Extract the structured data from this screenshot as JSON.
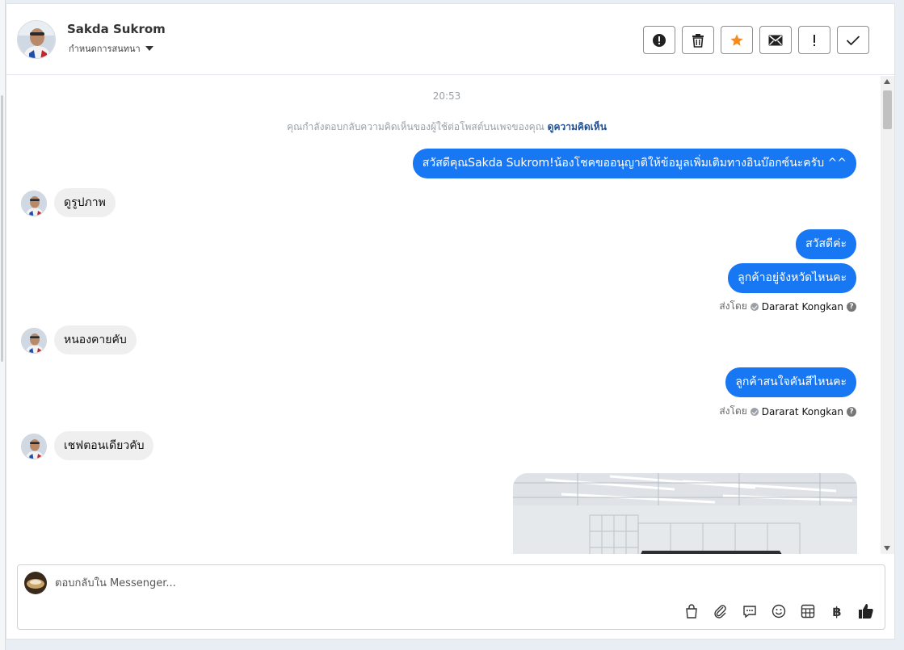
{
  "header": {
    "contact_name": "Sakda Sukrom",
    "conversation_label": "กำหนดการสนทนา",
    "actions": [
      {
        "name": "spam-button",
        "icon": "alert-circle-icon"
      },
      {
        "name": "delete-button",
        "icon": "trash-icon"
      },
      {
        "name": "star-button",
        "icon": "star-icon"
      },
      {
        "name": "mark-unread-button",
        "icon": "envelope-icon"
      },
      {
        "name": "important-button",
        "icon": "exclamation-icon"
      },
      {
        "name": "done-button",
        "icon": "check-icon"
      }
    ]
  },
  "thread": {
    "timestamp": "20:53",
    "reply_notice": "คุณกำลังตอบกลับความคิดเห็นของผู้ใช้ต่อโพสต์บนเพจของคุณ",
    "view_comment_link": "ดูความคิดเห็น",
    "messages": [
      {
        "direction": "out",
        "text": "สวัสดีคุณSakda Sukrom!น้องโชคขออนุญาติให้ข้อมูลเพิ่มเติมทางอินบ๊อกซ์นะครับ ^^"
      },
      {
        "direction": "in",
        "text": "ดูรูปภาพ"
      },
      {
        "direction": "out",
        "text": "สวัสดีค่ะ"
      },
      {
        "direction": "out",
        "text": "ลูกค้าอยู่จังหวัดไหนคะ"
      },
      {
        "direction": "in",
        "text": "หนองคายคับ"
      },
      {
        "direction": "out",
        "text": "ลูกค้าสนใจคันสีไหนคะ"
      },
      {
        "direction": "in",
        "text": "เชฟตอนเดียวคับ"
      }
    ],
    "sent_by_label": "ส่งโดย",
    "sent_by_agent": "Dararat Kongkan"
  },
  "composer": {
    "placeholder": "ตอบกลับใน Messenger...",
    "tools": [
      "shopping-bag-icon",
      "paperclip-icon",
      "saved-replies-icon",
      "emoji-icon",
      "calculator-icon",
      "baht-icon",
      "thumbs-up-icon"
    ],
    "baht_symbol": "฿"
  },
  "colors": {
    "accent": "#1877f2",
    "incoming_bubble": "#efefef",
    "star": "#f58a1f"
  }
}
